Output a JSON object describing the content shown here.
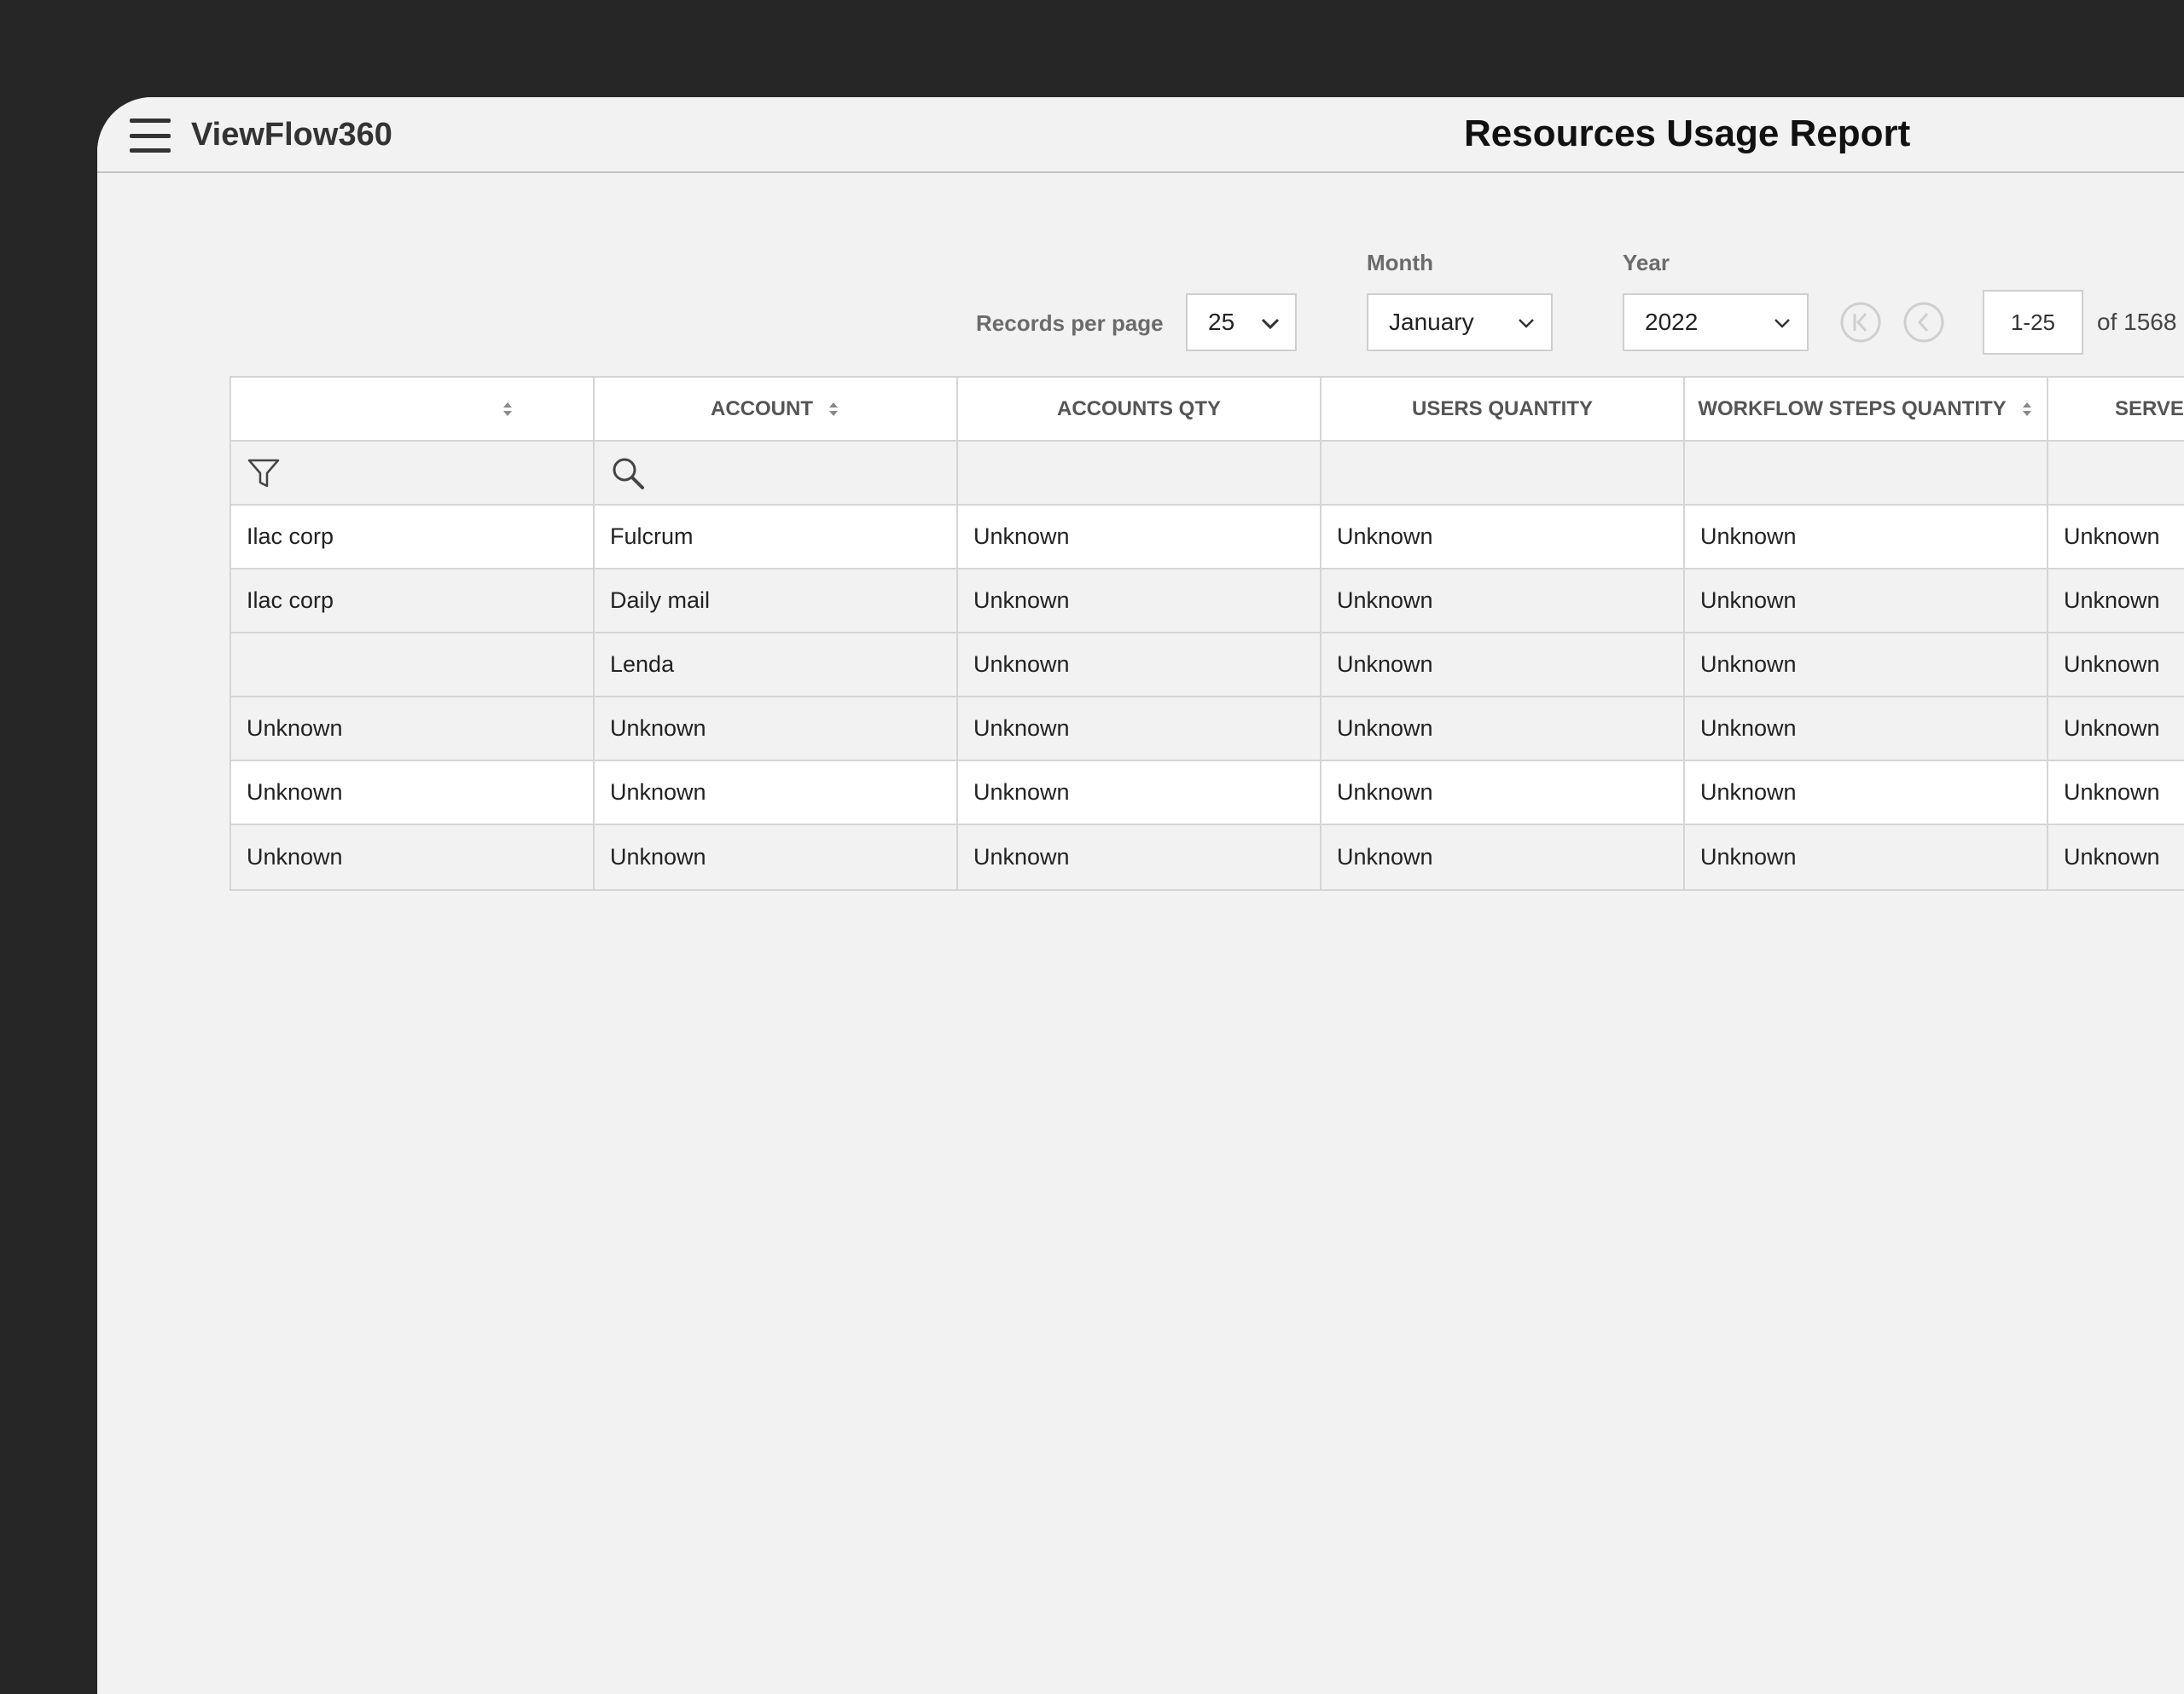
{
  "app": {
    "name": "ViewFlow360",
    "page_title": "Resources Usage Report"
  },
  "controls": {
    "records_label": "Records per page",
    "records_value": "25",
    "month_label": "Month",
    "month_value": "January",
    "year_label": "Year",
    "year_value": "2022",
    "page_range": "1-25",
    "total_text": "of 1568"
  },
  "table": {
    "headers": [
      "",
      "ACCOUNT",
      "ACCOUNTS QTY",
      "USERS QUANTITY",
      "WORKFLOW STEPS QUANTITY",
      "SERVE"
    ],
    "rows": [
      [
        "Ilac corp",
        "Fulcrum",
        "Unknown",
        "Unknown",
        "Unknown",
        "Unknown"
      ],
      [
        "Ilac corp",
        "Daily mail",
        "Unknown",
        "Unknown",
        "Unknown",
        "Unknown"
      ],
      [
        "",
        "Lenda",
        "Unknown",
        "Unknown",
        "Unknown",
        "Unknown"
      ],
      [
        "Unknown",
        "Unknown",
        "Unknown",
        "Unknown",
        "Unknown",
        "Unknown"
      ],
      [
        "Unknown",
        "Unknown",
        "Unknown",
        "Unknown",
        "Unknown",
        "Unknown"
      ],
      [
        "Unknown",
        "Unknown",
        "Unknown",
        "Unknown",
        "Unknown",
        "Unknown"
      ]
    ]
  },
  "icons": {
    "menu": "hamburger-menu-icon",
    "filter": "filter-icon",
    "search": "search-icon",
    "sort": "sort-icon",
    "first_page": "first-page-icon",
    "prev_page": "previous-page-icon",
    "dropdown": "chevron-down-icon"
  },
  "colors": {
    "frame": "#262626",
    "background": "#f2f2f2",
    "border": "#d5d5d5",
    "text": "#222222"
  }
}
